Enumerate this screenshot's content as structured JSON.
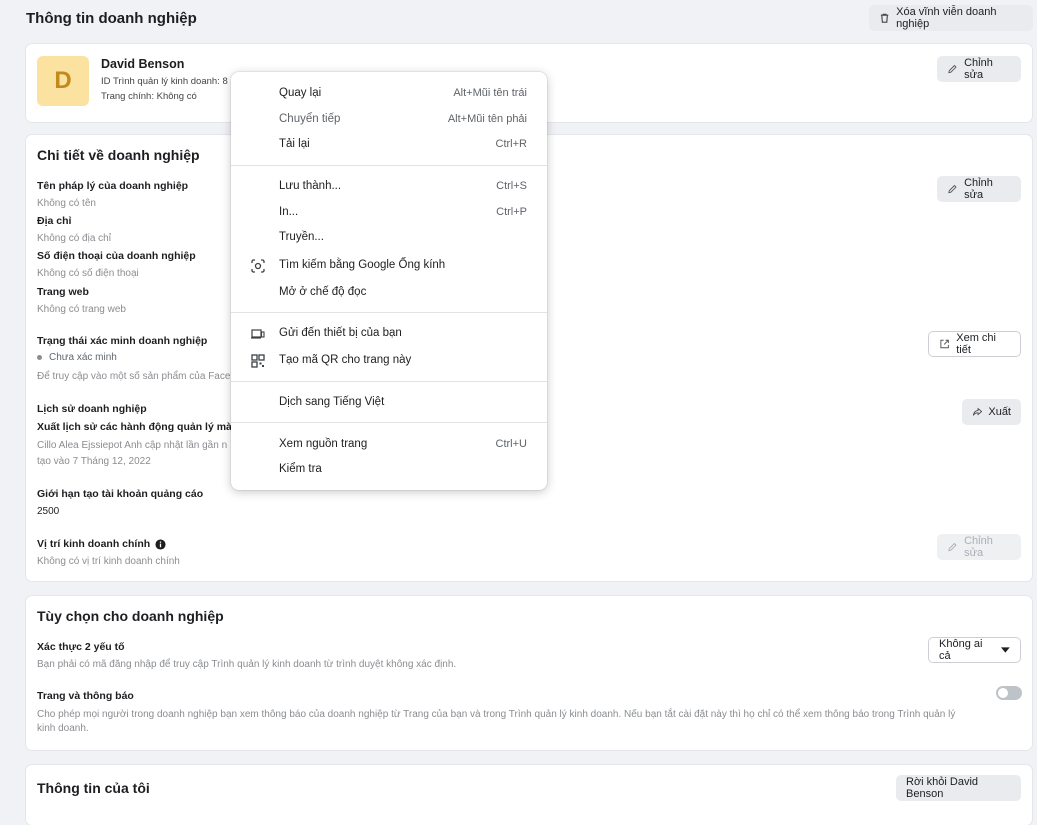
{
  "page_title": "Thông tin doanh nghiệp",
  "delete_button": "Xóa vĩnh viễn doanh nghiệp",
  "profile": {
    "avatar_letter": "D",
    "name": "David Benson",
    "id_line": "ID Trình quản lý kinh doanh: 8",
    "main_page": "Trang chính: Không có",
    "edit_label": "Chỉnh sửa"
  },
  "details": {
    "title": "Chi tiết về doanh nghiệp",
    "edit_label": "Chỉnh sửa",
    "legal_name_label": "Tên pháp lý của doanh nghiệp",
    "legal_name_value": "Không có tên",
    "address_label": "Địa chỉ",
    "address_value": "Không có địa chỉ",
    "phone_label": "Số điện thoại của doanh nghiệp",
    "phone_value": "Không có số điện thoại",
    "website_label": "Trang web",
    "website_value": "Không có trang web",
    "verify_label": "Trạng thái xác minh doanh nghiệp",
    "verify_status": "Chưa xác minh",
    "verify_note": "Để truy cập vào một số sản phẩm của Face",
    "view_details_label": "Xem chi tiết",
    "history_label": "Lịch sử doanh nghiệp",
    "history_export_label": "Xuất lịch sử các hành động quản lý mà mọ",
    "history_note1": "Cillo Alea Ejssiepot Anh cập nhật lần gần n",
    "history_note2": "tạo vào 7 Tháng 12, 2022",
    "export_label": "Xuất",
    "ad_limit_label": "Giới hạn tạo tài khoản quảng cáo",
    "ad_limit_value": "2500",
    "location_label": "Vị trí kinh doanh chính",
    "location_value": "Không có vị trí kinh doanh chính",
    "location_edit_label": "Chỉnh sửa"
  },
  "options": {
    "title": "Tùy chọn cho doanh nghiệp",
    "twofa_label": "Xác thực 2 yếu tố",
    "twofa_desc": "Bạn phải có mã đăng nhập để truy cập Trình quản lý kinh doanh từ trình duyệt không xác định.",
    "twofa_select": "Không ai cả",
    "pages_label": "Trang và thông báo",
    "pages_desc1": "Cho phép mọi người trong doanh nghiệp bạn xem thông báo của doanh nghiệp từ Trang của bạn và trong Trình quản lý kinh doanh. Nếu bạn tắt cài đặt này thì họ chỉ có thể xem thông báo trong Trình quản lý",
    "pages_desc2": "kinh doanh."
  },
  "my_info": {
    "title": "Thông tin của tôi",
    "leave_button": "Rời khỏi David Benson"
  },
  "context_menu": {
    "items": [
      {
        "label": "Quay lại",
        "shortcut": "Alt+Mũi tên trái"
      },
      {
        "label": "Chuyển tiếp",
        "shortcut": "Alt+Mũi tên phải"
      },
      {
        "label": "Tải lại",
        "shortcut": "Ctrl+R"
      },
      {
        "label": "Lưu thành...",
        "shortcut": "Ctrl+S"
      },
      {
        "label": "In...",
        "shortcut": "Ctrl+P"
      },
      {
        "label": "Truyền..."
      },
      {
        "label": "Tìm kiếm bằng Google Ống kính",
        "icon": "google-lens-icon"
      },
      {
        "label": "Mở ở chế độ đọc"
      },
      {
        "label": "Gửi đến thiết bị của bạn",
        "icon": "devices-icon"
      },
      {
        "label": "Tạo mã QR cho trang này",
        "icon": "qr-code-icon"
      },
      {
        "label": "Dịch sang Tiếng Việt"
      },
      {
        "label": "Xem nguồn trang",
        "shortcut": "Ctrl+U"
      },
      {
        "label": "Kiểm tra"
      }
    ]
  },
  "colors": {
    "avatar_bg": "#fbe2a1",
    "avatar_fg": "#c18a1b",
    "page_bg": "#f0f2f5"
  }
}
